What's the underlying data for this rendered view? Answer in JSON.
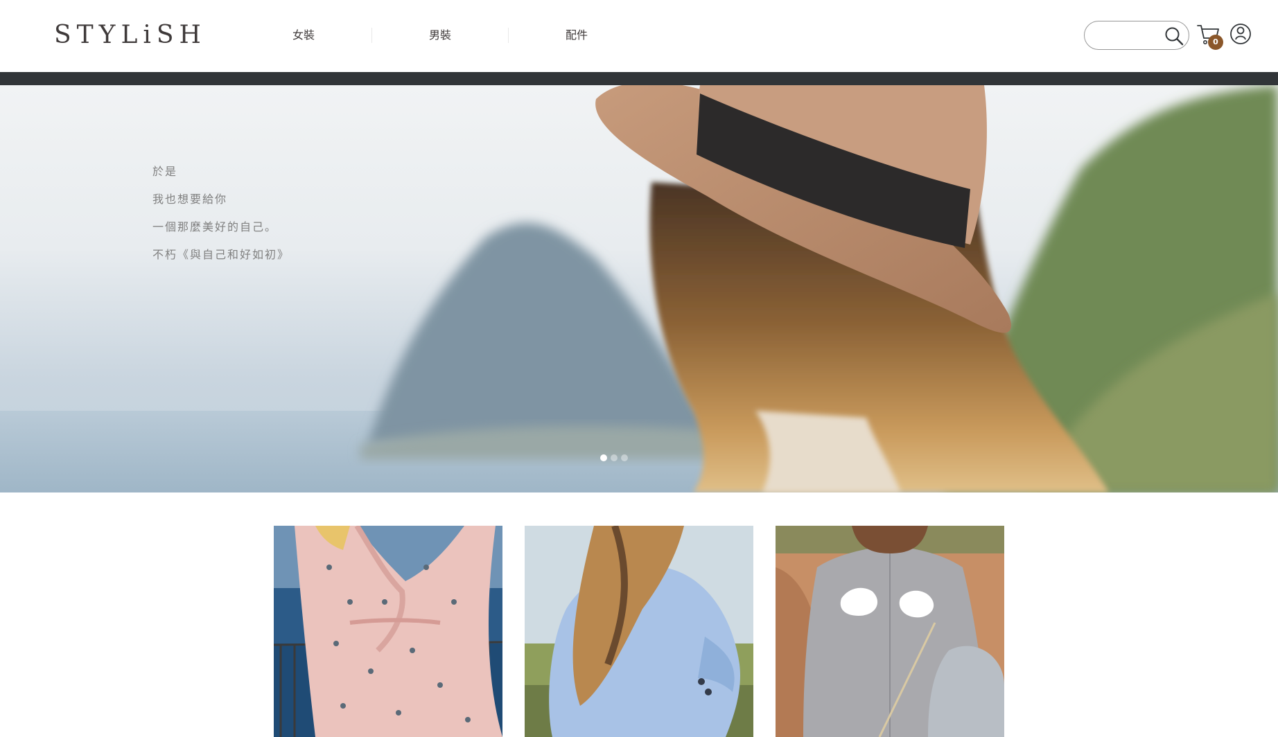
{
  "header": {
    "logo_text": "STYLiSH",
    "nav": [
      {
        "label": "女裝"
      },
      {
        "label": "男裝"
      },
      {
        "label": "配件"
      }
    ],
    "search": {
      "value": "",
      "placeholder": ""
    },
    "cart": {
      "count": "0"
    },
    "icons": {
      "search": "search-icon",
      "cart": "cart-icon",
      "member": "member-icon"
    }
  },
  "hero": {
    "story_lines": [
      "於是",
      "我也想要給你",
      "一個那麼美好的自己。",
      "不朽《與自己和好如初》"
    ],
    "carousel": {
      "total_slides": 3,
      "active_index": 0
    }
  },
  "products": [
    {
      "image": "pink-bird-print-wrap-dress"
    },
    {
      "image": "light-blue-blouse"
    },
    {
      "image": "gray-shirt-with-shell-patches"
    }
  ],
  "colors": {
    "brand_brown": "#8b572a",
    "text_dark": "#3f3a3a",
    "dark_bar": "#313538",
    "hero_text": "#808080"
  }
}
